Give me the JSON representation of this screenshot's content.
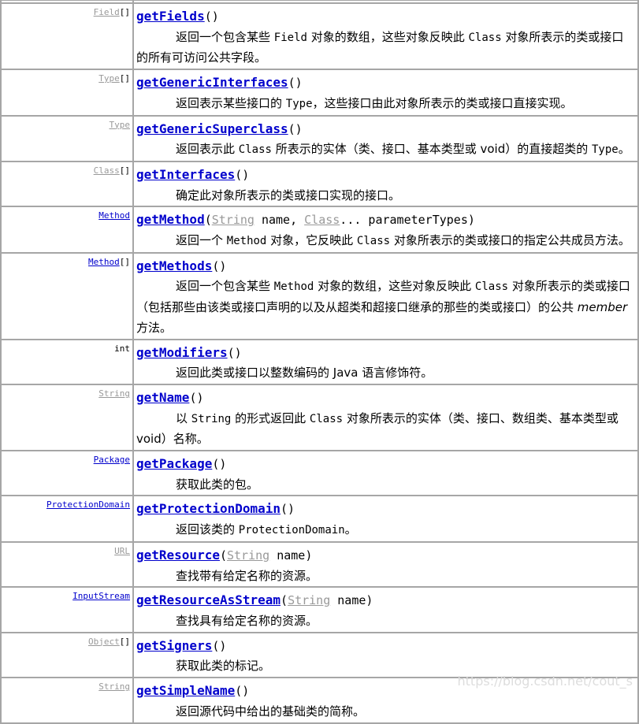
{
  "rows": [
    {
      "type": "Field",
      "type_style": "v",
      "suffix": "[]",
      "method": "getFields",
      "params": [],
      "desc": [
        {
          "t": "返回一个包含某些 "
        },
        {
          "t": "Field",
          "s": "code"
        },
        {
          "t": " 对象的数组，这些对象反映此 "
        },
        {
          "t": "Class",
          "s": "code"
        },
        {
          "t": " 对象所表示的类或接口的所有可访问公共字段。"
        }
      ]
    },
    {
      "type": "Type",
      "type_style": "v",
      "suffix": "[]",
      "method": "getGenericInterfaces",
      "params": [],
      "desc": [
        {
          "t": "返回表示某些接口的 "
        },
        {
          "t": "Type",
          "s": "code"
        },
        {
          "t": "，这些接口由此对象所表示的类或接口直接实现。"
        }
      ]
    },
    {
      "type": "Type",
      "type_style": "v",
      "suffix": "",
      "method": "getGenericSuperclass",
      "params": [],
      "desc": [
        {
          "t": "返回表示此 "
        },
        {
          "t": "Class",
          "s": "code"
        },
        {
          "t": " 所表示的实体（类、接口、基本类型或 void）的直接超类的 "
        },
        {
          "t": "Type",
          "s": "code"
        },
        {
          "t": "。"
        }
      ]
    },
    {
      "type": "Class",
      "type_style": "v",
      "suffix": "[]",
      "method": "getInterfaces",
      "params": [],
      "desc": [
        {
          "t": "确定此对象所表示的类或接口实现的接口。"
        }
      ]
    },
    {
      "type": "Method",
      "type_style": "b",
      "suffix": "",
      "method": "getMethod",
      "params": [
        {
          "t": "String",
          "s": "link"
        },
        {
          "t": " name, "
        },
        {
          "t": "Class",
          "s": "link"
        },
        {
          "t": "... parameterTypes"
        }
      ],
      "desc": [
        {
          "t": "返回一个 "
        },
        {
          "t": "Method",
          "s": "code"
        },
        {
          "t": " 对象，它反映此 "
        },
        {
          "t": "Class",
          "s": "code"
        },
        {
          "t": " 对象所表示的类或接口的指定公共成员方法。"
        }
      ]
    },
    {
      "type": "Method",
      "type_style": "b",
      "suffix": "[]",
      "method": "getMethods",
      "params": [],
      "desc": [
        {
          "t": "返回一个包含某些 "
        },
        {
          "t": "Method",
          "s": "code"
        },
        {
          "t": " 对象的数组，这些对象反映此 "
        },
        {
          "t": "Class",
          "s": "code"
        },
        {
          "t": " 对象所表示的类或接口（包括那些由该类或接口声明的以及从超类和超接口继承的那些的类或接口）的公共 "
        },
        {
          "t": "member",
          "s": "it"
        },
        {
          "t": " 方法。"
        }
      ]
    },
    {
      "type": "int",
      "type_style": "plain",
      "suffix": "",
      "method": "getModifiers",
      "params": [],
      "desc": [
        {
          "t": "返回此类或接口以整数编码的 Java 语言修饰符。"
        }
      ]
    },
    {
      "type": "String",
      "type_style": "v",
      "suffix": "",
      "method": "getName",
      "params": [],
      "desc": [
        {
          "t": "以 "
        },
        {
          "t": "String",
          "s": "code"
        },
        {
          "t": " 的形式返回此 "
        },
        {
          "t": "Class",
          "s": "code"
        },
        {
          "t": " 对象所表示的实体（类、接口、数组类、基本类型或 void）名称。"
        }
      ]
    },
    {
      "type": "Package",
      "type_style": "b",
      "suffix": "",
      "method": "getPackage",
      "params": [],
      "desc": [
        {
          "t": "获取此类的包。"
        }
      ]
    },
    {
      "type": "ProtectionDomain",
      "type_style": "b",
      "suffix": "",
      "method": "getProtectionDomain",
      "params": [],
      "desc": [
        {
          "t": "返回该类的 "
        },
        {
          "t": "ProtectionDomain",
          "s": "code"
        },
        {
          "t": "。"
        }
      ]
    },
    {
      "type": "URL",
      "type_style": "v",
      "suffix": "",
      "method": "getResource",
      "params": [
        {
          "t": "String",
          "s": "link"
        },
        {
          "t": " name"
        }
      ],
      "desc": [
        {
          "t": "查找带有给定名称的资源。"
        }
      ]
    },
    {
      "type": "InputStream",
      "type_style": "b",
      "suffix": "",
      "method": "getResourceAsStream",
      "params": [
        {
          "t": "String",
          "s": "link"
        },
        {
          "t": " name"
        }
      ],
      "desc": [
        {
          "t": "查找具有给定名称的资源。"
        }
      ]
    },
    {
      "type": "Object",
      "type_style": "v",
      "suffix": "[]",
      "method": "getSigners",
      "params": [],
      "desc": [
        {
          "t": "获取此类的标记。"
        }
      ]
    },
    {
      "type": "String",
      "type_style": "v",
      "suffix": "",
      "method": "getSimpleName",
      "params": [],
      "desc": [
        {
          "t": "返回源代码中给出的基础类的简称。"
        }
      ]
    }
  ],
  "watermark": "https://blog.csdn.net/cout_s"
}
